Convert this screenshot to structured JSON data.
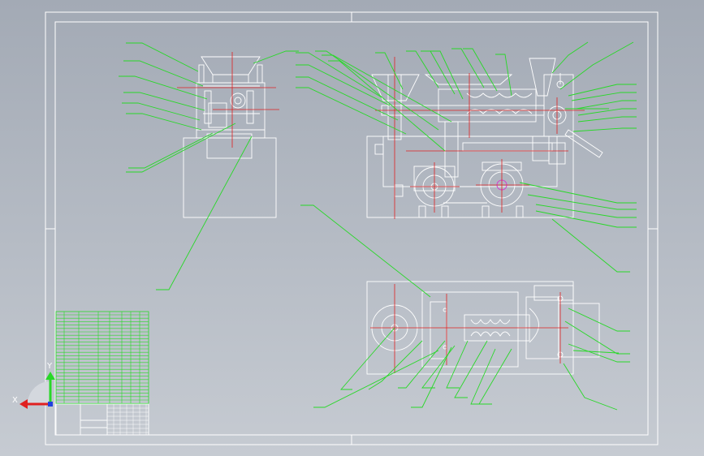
{
  "colors": {
    "background_top": "#a3aab5",
    "background_bottom": "#c6cbd2",
    "drawing_lines": "#ffffff",
    "centerlines": "#e02020",
    "leader_lines": "#28d828",
    "highlight": "#d040d0"
  },
  "axis_triad": {
    "x_label": "X",
    "y_label": "Y",
    "x_axis_color": "#e02020",
    "y_axis_color": "#28d828",
    "z_axis_color": "#2040e0"
  },
  "icons": [
    "ucs-axis-icon"
  ]
}
